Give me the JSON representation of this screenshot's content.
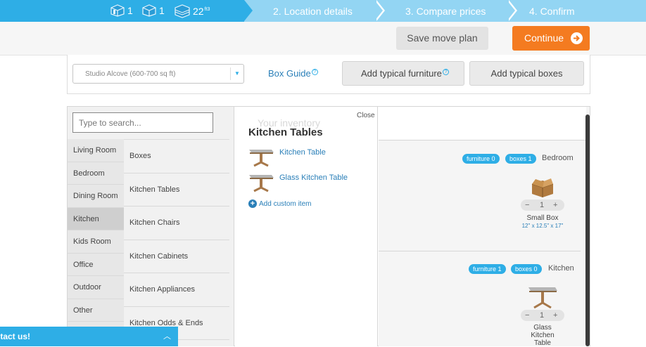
{
  "progress": {
    "stats": [
      {
        "icon": "furniture-icon",
        "value": "1"
      },
      {
        "icon": "box-icon",
        "value": "1"
      },
      {
        "icon": "volume-icon",
        "value": "22",
        "unit": "ft3"
      }
    ],
    "steps": [
      "2. Location details",
      "3. Compare prices",
      "4. Confirm"
    ],
    "colors": {
      "active": "#2eaee6",
      "inactive": "#93d5f3"
    }
  },
  "actions": {
    "save_label": "Save move plan",
    "continue_label": "Continue",
    "continue_color": "#f47b20"
  },
  "settings": {
    "home_size": "Studio Alcove (600-700 sq ft)",
    "box_guide": "Box Guide",
    "add_furniture": "Add typical furniture",
    "add_boxes": "Add typical boxes",
    "help": "?"
  },
  "search": {
    "placeholder": "Type to search..."
  },
  "rooms": [
    "Living Room",
    "Bedroom",
    "Dining Room",
    "Kitchen",
    "Kids Room",
    "Office",
    "Outdoor",
    "Other"
  ],
  "active_room": "Kitchen",
  "categories": [
    "Boxes",
    "Kitchen Tables",
    "Kitchen Chairs",
    "Kitchen Cabinets",
    "Kitchen Appliances",
    "Kitchen Odds & Ends"
  ],
  "items_panel": {
    "ghost": "Your inventory",
    "close": "Close",
    "title": "Kitchen Tables",
    "items": [
      "Kitchen Table",
      "Glass Kitchen Table"
    ],
    "add_custom": "Add custom item"
  },
  "inventory": {
    "sections": [
      {
        "badges": [
          "furniture 0",
          "boxes 1"
        ],
        "room": "Bedroom",
        "item": {
          "name": "Small Box",
          "dims": "12\" x 12.5\" x 17\"",
          "qty": "1",
          "icon": "cardboard-box-icon"
        }
      },
      {
        "badges": [
          "furniture 1",
          "boxes 0"
        ],
        "room": "Kitchen",
        "item": {
          "name_lines": [
            "Glass",
            "Kitchen",
            "Table"
          ],
          "qty": "1",
          "icon": "table-icon"
        }
      }
    ],
    "minus": "−",
    "plus": "+"
  },
  "contact": {
    "label": "ntact us!"
  }
}
